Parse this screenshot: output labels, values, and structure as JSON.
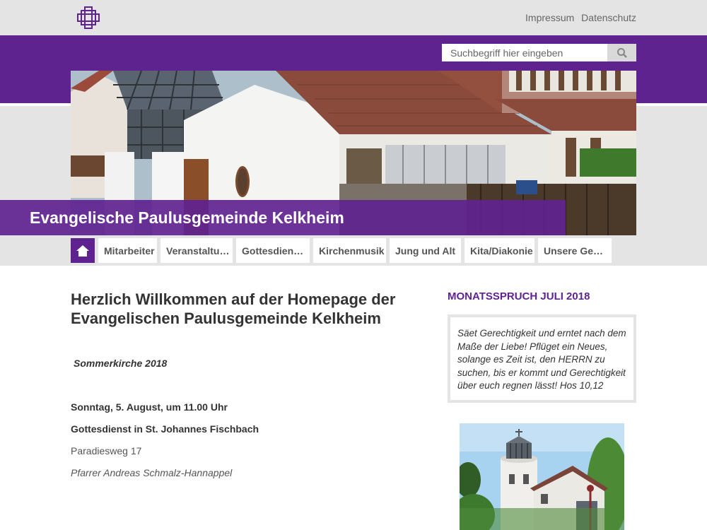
{
  "header": {
    "links": [
      "Impressum",
      "Datenschutz"
    ]
  },
  "search": {
    "placeholder": "Suchbegriff hier eingeben"
  },
  "hero": {
    "title": "Evangelische Paulusgemeinde Kelkheim"
  },
  "nav": {
    "items": [
      "Mitarbeiter",
      "Veranstaltu…",
      "Gottesdien…",
      "Kirchenmusik",
      "Jung und Alt",
      "Kita/Diakonie",
      "Unsere Ge…"
    ]
  },
  "main": {
    "title_line1": "Herzlich Willkommen auf der Homepage der",
    "title_line2": "Evangelischen Paulusgemeinde Kelkheim",
    "subtitle": "Sommerkirche 2018",
    "date_line": "Sonntag, 5. August, um 11.00 Uhr",
    "service_line": "Gottesdienst in St. Johannes Fischbach",
    "address": "Paradiesweg 17",
    "pastor": "Pfarrer Andreas Schmalz-Hannappel"
  },
  "sidebar": {
    "heading": "MONATSSPRUCH JULI 2018",
    "verse": "Säet Gerechtigkeit und erntet nach dem Maße der Liebe! Pflüget ein Neues, solange es Zeit ist, den HERRN zu suchen, bis er kommt und Gerechtigkeit über euch regnen lässt! Hos 10,12"
  },
  "colors": {
    "brand_purple": "#5f2390",
    "light_grey": "#e4e4e4"
  }
}
